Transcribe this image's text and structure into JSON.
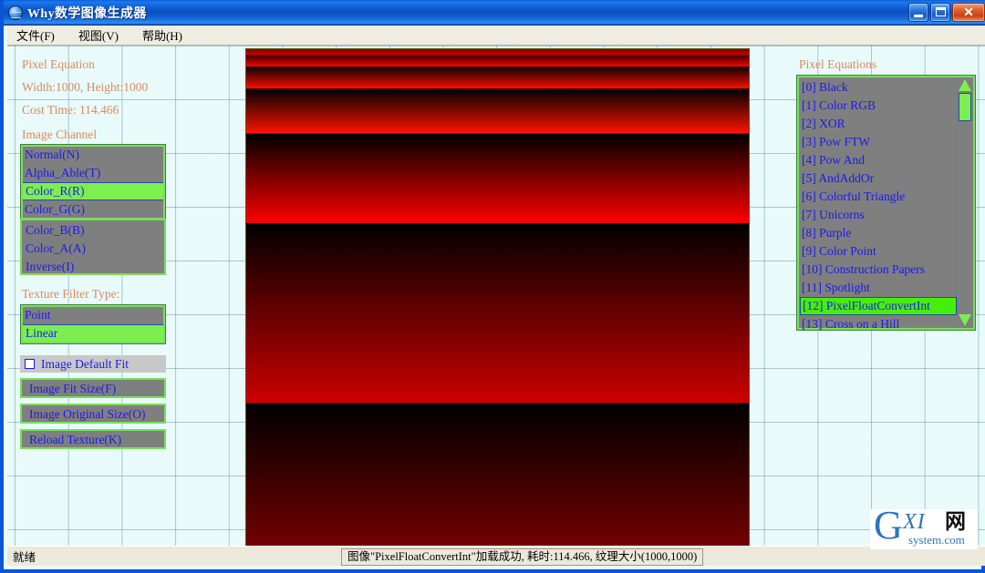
{
  "window": {
    "title": "Why数学图像生成器",
    "icon": "globe-icon",
    "minimize_label": "_",
    "maximize_label": "❐",
    "close_label": "✕"
  },
  "menubar": {
    "items": [
      {
        "label": "文件(F)",
        "name": "menu-file"
      },
      {
        "label": "视图(V)",
        "name": "menu-view"
      },
      {
        "label": "帮助(H)",
        "name": "menu-help"
      }
    ]
  },
  "left_panel": {
    "info": {
      "pixel_equation_label": "Pixel Equation",
      "size_label": "Width:1000, Height:1000",
      "cost_time_label": "Cost Time: 114.466"
    },
    "image_channel": {
      "title": "Image Channel",
      "items": [
        {
          "label": "Normal(N)",
          "selected": false
        },
        {
          "label": "Alpha_Able(T)",
          "selected": false
        },
        {
          "label": "Color_R(R)",
          "selected": true
        },
        {
          "label": "Color_G(G)",
          "selected": false
        },
        {
          "label": "Color_B(B)",
          "selected": false
        },
        {
          "label": "Color_A(A)",
          "selected": false
        },
        {
          "label": "Inverse(I)",
          "selected": false
        }
      ]
    },
    "texture_filter": {
      "title": "Texture Filter Type:",
      "items": [
        {
          "label": "Point",
          "selected": false
        },
        {
          "label": "Linear",
          "selected": true
        }
      ]
    },
    "checkbox": {
      "label": "Image Default Fit",
      "checked": false
    },
    "buttons": [
      {
        "label": "Image Fit Size(F)",
        "name": "image-fit-size-button"
      },
      {
        "label": "Image Original Size(O)",
        "name": "image-original-size-button"
      },
      {
        "label": "Reload Texture(K)",
        "name": "reload-texture-button"
      }
    ]
  },
  "right_panel": {
    "title": "Pixel Equations",
    "items": [
      {
        "label": "[0] Black",
        "selected": false
      },
      {
        "label": "[1] Color RGB",
        "selected": false
      },
      {
        "label": "[2] XOR",
        "selected": false
      },
      {
        "label": "[3] Pow FTW",
        "selected": false
      },
      {
        "label": "[4] Pow And",
        "selected": false
      },
      {
        "label": "[5] AndAddOr",
        "selected": false
      },
      {
        "label": "[6] Colorful Triangle",
        "selected": false
      },
      {
        "label": "[7] Unicorns",
        "selected": false
      },
      {
        "label": "[8] Purple",
        "selected": false
      },
      {
        "label": "[9] Color Point",
        "selected": false
      },
      {
        "label": "[10] Construction Papers",
        "selected": false
      },
      {
        "label": "[11] Spotlight",
        "selected": false
      },
      {
        "label": "[12] PixelFloatConvertInt",
        "selected": true
      },
      {
        "label": "[13] Cross on a Hill",
        "selected": false
      }
    ],
    "scrollbar": {
      "up_arrow": "scroll-up-arrow",
      "down_arrow": "scroll-down-arrow"
    }
  },
  "canvas": {
    "description": "PixelFloatConvertInt red sawtooth gradient render",
    "accent_color": "#ff0000",
    "bands": [
      {
        "top_pct": 0.0,
        "height_pct": 1.1,
        "from": "#7a0000",
        "to": "#c60000"
      },
      {
        "top_pct": 1.1,
        "height_pct": 2.2,
        "from": "#420000",
        "to": "#ff0000"
      },
      {
        "top_pct": 3.3,
        "height_pct": 4.5,
        "from": "#0d0000",
        "to": "#ff0000"
      },
      {
        "top_pct": 7.8,
        "height_pct": 9.0,
        "from": "#000000",
        "to": "#ff1a00"
      },
      {
        "top_pct": 16.8,
        "height_pct": 18.0,
        "from": "#000000",
        "to": "#ff0000"
      },
      {
        "top_pct": 34.8,
        "height_pct": 36.0,
        "from": "#000000",
        "to": "#c40000"
      },
      {
        "top_pct": 70.8,
        "height_pct": 29.2,
        "from": "#000000",
        "to": "#6e0000"
      }
    ]
  },
  "statusbar": {
    "left_text": "就绪",
    "right_text": "图像\"PixelFloatConvertInt\"加载成功, 耗时:114.466, 纹理大小(1000,1000)"
  },
  "watermark": {
    "letter": "G",
    "mid": "XI",
    "cn": "网",
    "domain": "system.com"
  },
  "colors": {
    "background": "#e8fbfa",
    "grid_line": "#5a82a0",
    "listbox_bg": "#7f7f7f",
    "listbox_border": "#77e05a",
    "selection": "#7dee4f",
    "text_blue": "#1a1aee",
    "label_orange": "#d98a5f",
    "titlebar": "#0a56d6"
  }
}
